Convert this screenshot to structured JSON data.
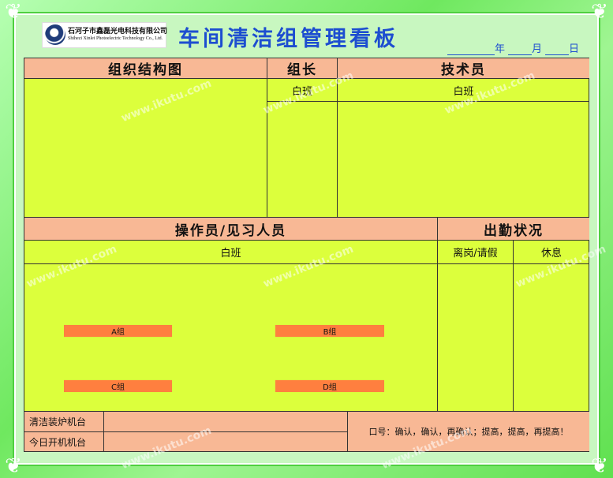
{
  "company": {
    "name_cn": "石河子市鑫磊光电科技有限公司",
    "name_en": "Shihezi Xinlei Photoelectric Technology Co., Ltd."
  },
  "title": "车间清洁组管理看板",
  "date": {
    "year": "年",
    "month": "月",
    "day": "日"
  },
  "sections": {
    "org_chart": "组织结构图",
    "leader": {
      "header": "组长",
      "shift": "白班"
    },
    "technician": {
      "header": "技术员",
      "shift": "白班"
    },
    "operators": {
      "header": "操作员/见习人员",
      "shift": "白班"
    },
    "attendance": {
      "header": "出勤状况",
      "leave": "离岗/请假",
      "rest": "休息"
    }
  },
  "groups": [
    "A组",
    "B组",
    "C组",
    "D组"
  ],
  "footer": {
    "row1": "清洁装炉机台",
    "row2": "今日开机机台",
    "slogan": "口号：确认，确认，再确认；提高，提高，再提高！"
  },
  "watermark": "www.ikutu.com",
  "colors": {
    "frame_green": "#7fef6f",
    "board_yellow": "#dcff3c",
    "header_salmon": "#f8b895",
    "group_orange": "#ff7f3f",
    "title_blue": "#1d4ed0"
  }
}
